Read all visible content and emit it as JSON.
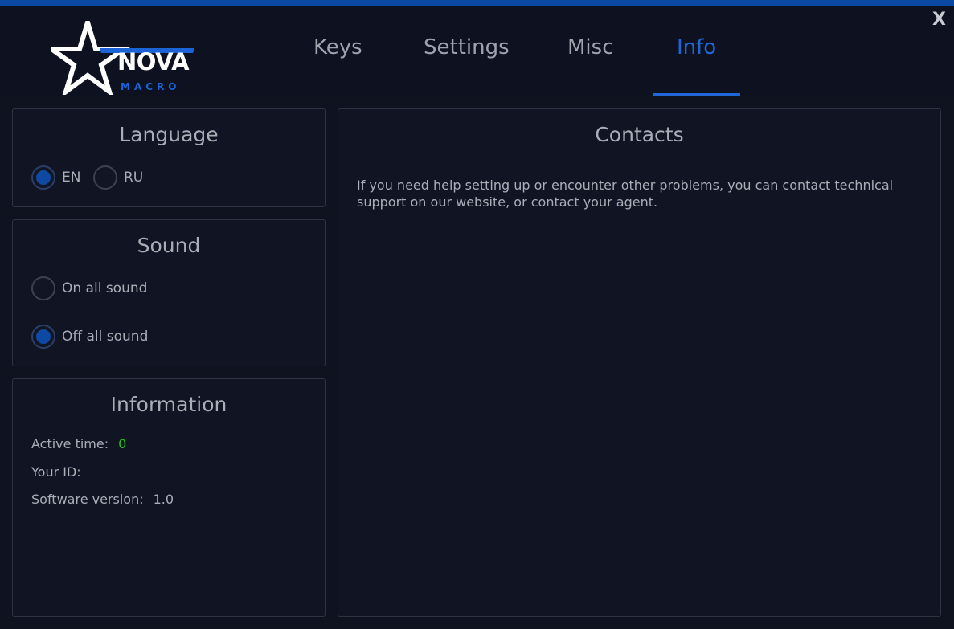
{
  "window": {
    "close_label": "X"
  },
  "logo": {
    "main": "NOVA",
    "sub": "MACRO"
  },
  "tabs": [
    {
      "label": "Keys"
    },
    {
      "label": "Settings"
    },
    {
      "label": "Misc"
    },
    {
      "label": "Info",
      "active": true
    }
  ],
  "language": {
    "title": "Language",
    "options": [
      {
        "label": "EN",
        "checked": true
      },
      {
        "label": "RU",
        "checked": false
      }
    ]
  },
  "sound": {
    "title": "Sound",
    "options": [
      {
        "label": "On all sound",
        "checked": false
      },
      {
        "label": "Off all sound",
        "checked": true
      }
    ]
  },
  "information": {
    "title": "Information",
    "active_time_label": "Active time:",
    "active_time_value": "0",
    "your_id_label": "Your ID:",
    "your_id_value": "",
    "version_label": "Software version:",
    "version_value": "1.0"
  },
  "contacts": {
    "title": "Contacts",
    "text": "If you need help setting up or encounter other problems, you can contact technical support on our website, or contact your agent."
  },
  "colors": {
    "accent": "#1f66d6",
    "background": "#0f1320",
    "active_time": "#22c21f"
  }
}
